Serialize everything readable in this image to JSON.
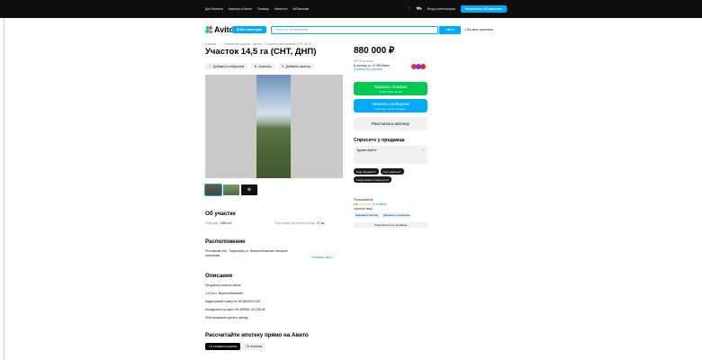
{
  "topbar": {
    "links": [
      "Для бизнеса",
      "Карьера в Авито",
      "Помощь",
      "Каталоги",
      "#яПомогаю"
    ],
    "login_label": "Вход и регистрация",
    "post_label": "Разместить объявление",
    "heart_icon": "heart-icon",
    "cart_icon": "cart-icon"
  },
  "header": {
    "logo_text": "Avito",
    "categories_label": "Все категории",
    "search_placeholder": "Поиск по объявлениям",
    "find_label": "Найти",
    "region_label": "Во всех регионах"
  },
  "breadcrumbs": "Главная · … · Земельные участки · Купить · Сельскохозяйственный (СНТ, ДНП)",
  "listing": {
    "title": "Участок 14,5 га (СНТ, ДНП)",
    "actions": [
      "Добавить в избранное",
      "Сравнить",
      "Добавить заметку"
    ],
    "thumb_more": "⊕"
  },
  "about": {
    "heading": "Об участке",
    "area_label": "Площадь:",
    "area_value": "1450 сот.",
    "distance_label": "Расстояние до центра города:",
    "distance_value": "27 км"
  },
  "location": {
    "heading": "Расположение",
    "address": "Ростовская обл., Тацинский р-н, Верхнеобливское сельское",
    "address_line2": "поселение",
    "map_link": "Показать карту"
  },
  "description": {
    "heading": "Описание",
    "lines": [
      "Продается сельхоз земля.",
      "14,5 га х. Верхнеобливский",
      "Кадастровый номер 61:38:0600003:1287",
      "Координаты на карте 48.409948, 41.478108",
      "Либо возможна сдача в аренду"
    ]
  },
  "mortgage": {
    "heading": "Рассчитайте ипотеку прямо на Авито",
    "tabs": [
      "От стоимости жилья",
      "От платежа"
    ]
  },
  "sidebar": {
    "price": "880 000 ₽",
    "price_note": "607 ₽ за сотку",
    "mortgage_note": "В ипотеку от 19 336 ₽/мес.",
    "mortgage_link": "Посмотреть условия",
    "phone_btn": "Показать телефон",
    "phone_masked": "8 9XX XXX-XX-XX",
    "message_btn": "Написать сообщение",
    "message_sub": "Отвечает около 30 минут",
    "calc_btn": "Рассчитать ипотеку",
    "ask_title": "Спросите у продавца",
    "message_placeholder": "Здравствуйте!",
    "chips": [
      "Ещё продаёте?",
      "Торг уместен?",
      "Когда можно посмотреть?"
    ]
  },
  "seller": {
    "name": "Пользователь",
    "rating": "4,8",
    "stars": "★★★★★",
    "reviews": "8 отзывов",
    "type": "Частное лицо",
    "badges": [
      "Надёжный партнёр",
      "Документы проверены"
    ],
    "subscribe": "Подписаться на продавца"
  }
}
